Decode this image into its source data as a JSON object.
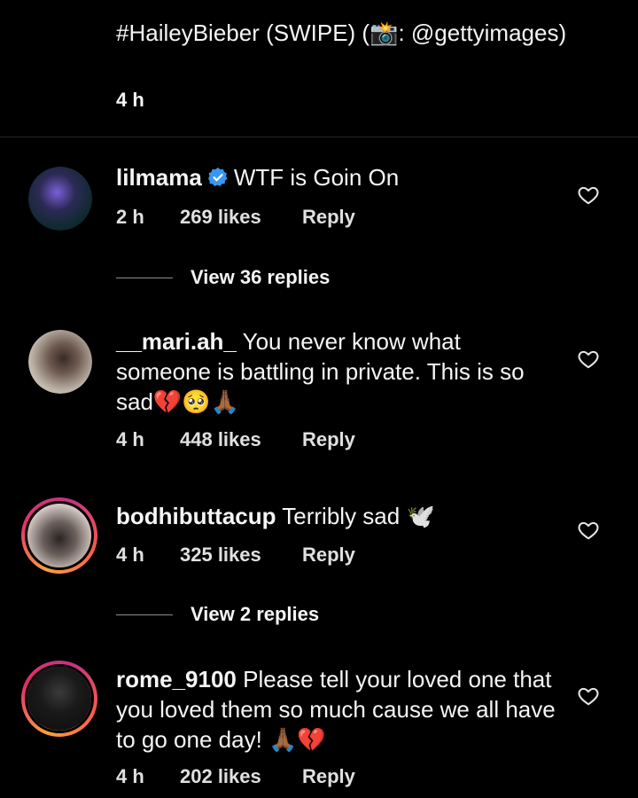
{
  "caption": {
    "text": "#HaileyBieber (SWIPE) (📸: @gettyimages)",
    "time": "4 h"
  },
  "comments": [
    {
      "username": "lilmama",
      "verified": true,
      "text": "WTF is Goin On",
      "time": "2 h",
      "likes": "269 likes",
      "reply": "Reply",
      "view_replies": "View 36 replies"
    },
    {
      "username": "__mari.ah_",
      "verified": false,
      "text": "You never know what someone is battling in private. This is so sad💔🥺🙏🏾",
      "time": "4 h",
      "likes": "448 likes",
      "reply": "Reply"
    },
    {
      "username": "bodhibuttacup",
      "verified": false,
      "text": "Terribly sad 🕊️",
      "time": "4 h",
      "likes": "325 likes",
      "reply": "Reply",
      "view_replies": "View 2 replies"
    },
    {
      "username": "rome_9100",
      "verified": false,
      "text": "Please tell your loved one that you loved them so much cause we all have to go one day! 🙏🏾💔",
      "time": "4 h",
      "likes": "202 likes",
      "reply": "Reply"
    }
  ],
  "icons": {
    "verified_badge": "verified-badge-icon",
    "like": "heart-outline-icon"
  },
  "colors": {
    "background": "#000000",
    "text": "#f5f5f5",
    "verified": "#3897f0",
    "story_ring_start": "#f9a03f",
    "story_ring_end": "#c13584"
  }
}
